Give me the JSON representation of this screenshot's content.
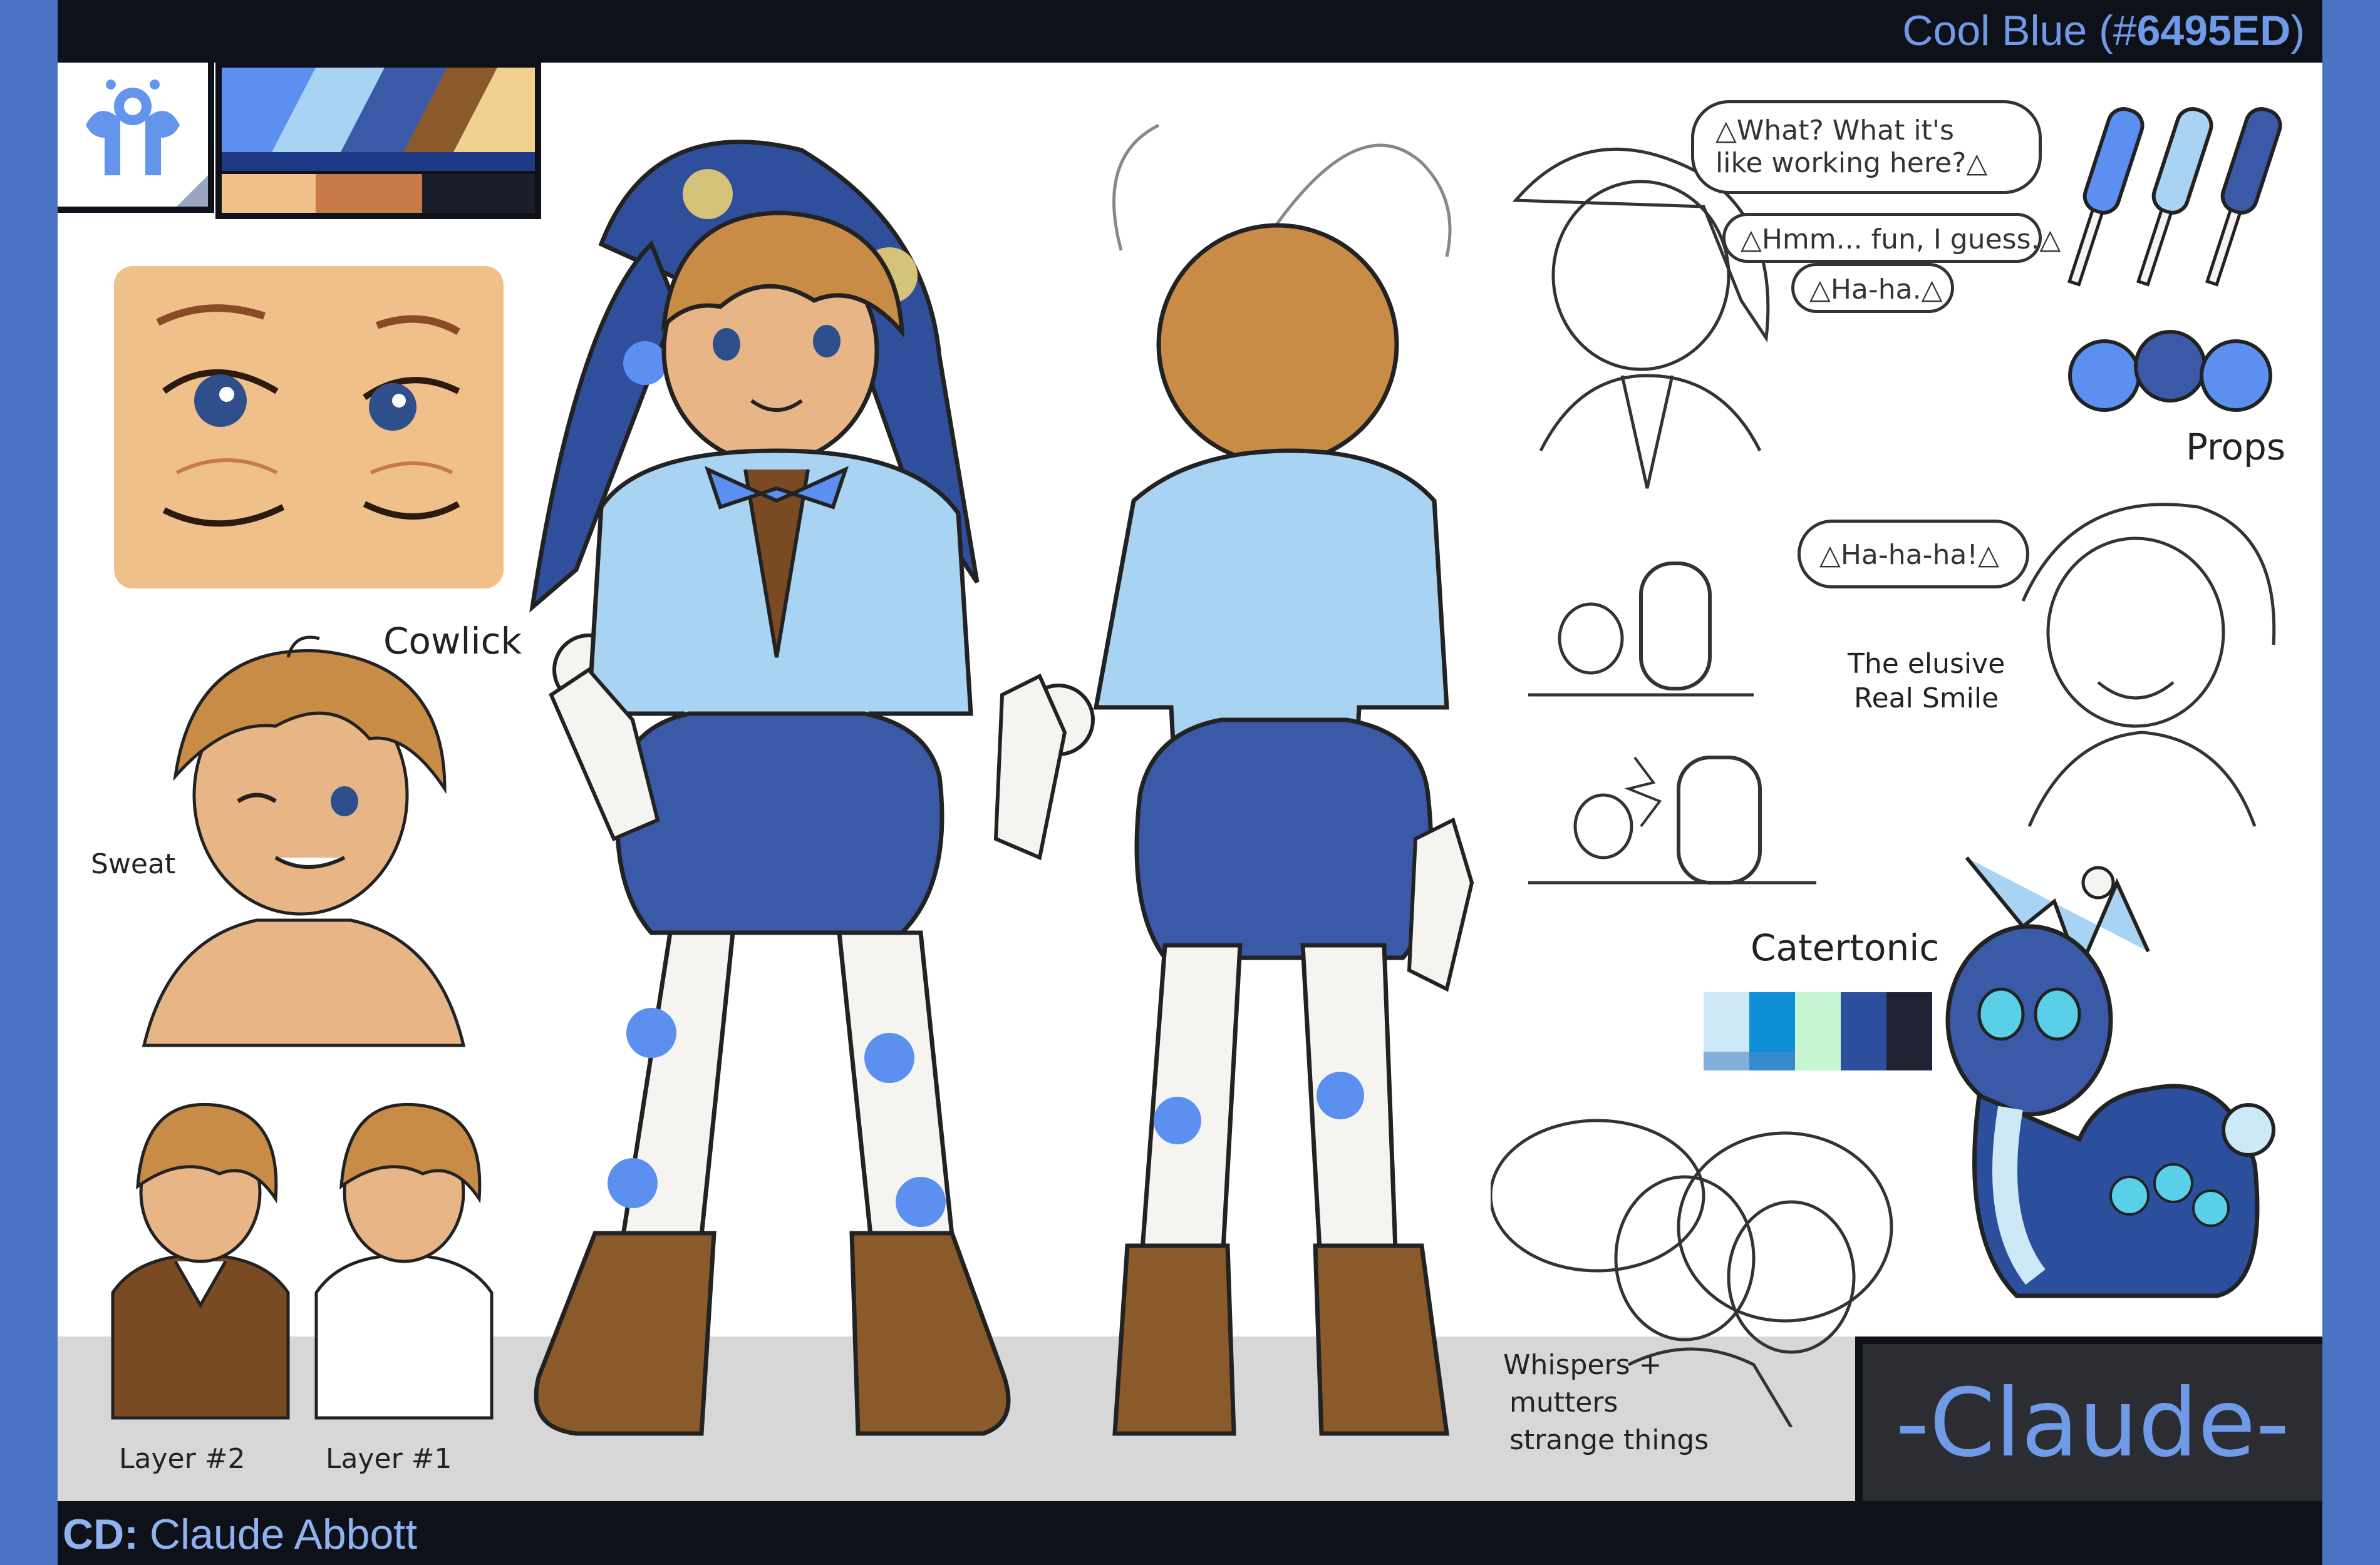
{
  "header": {
    "color_name": "Cool Blue (#",
    "color_hex": "6495ED",
    "color_suffix": ")"
  },
  "footer": {
    "cd_label": "CD:",
    "cd_name": "Claude Abbott"
  },
  "character_name": "-Claude-",
  "labels": {
    "cowlick": "Cowlick",
    "sweat": "Sweat",
    "layer2": "Layer #2",
    "layer1": "Layer #1",
    "props": "Props",
    "catertonic": "Catertonic",
    "whispers_line1": "Whispers +",
    "whispers_line2": "mutters",
    "whispers_line3": "strange things",
    "real_smile_line1": "The elusive",
    "real_smile_line2": "Real Smile"
  },
  "speech": {
    "line1": "△What? What it's",
    "line1b": "like working here?△",
    "line2": "△Hmm... fun, I guess.△",
    "line3": "△Ha-ha.△",
    "laugh": "△Ha-ha-ha!△"
  },
  "colors": {
    "accent": "#6495ED",
    "frame": "#4b73c4",
    "dark": "#0f1118",
    "main_palette": [
      "#5b8ff0",
      "#a9d3f2",
      "#3a5aa8",
      "#8a5a2b",
      "#f0d28e"
    ],
    "skin_palette": [
      "#f0c08a",
      "#c77a45",
      "#7a3a1a",
      "#1b1e2a"
    ],
    "catertonic_palette": [
      "#cde8f6",
      "#0f8fd6",
      "#c6f5d2",
      "#2b4f9c",
      "#1e2233"
    ]
  },
  "icons": [
    "character-emblem-icon"
  ]
}
